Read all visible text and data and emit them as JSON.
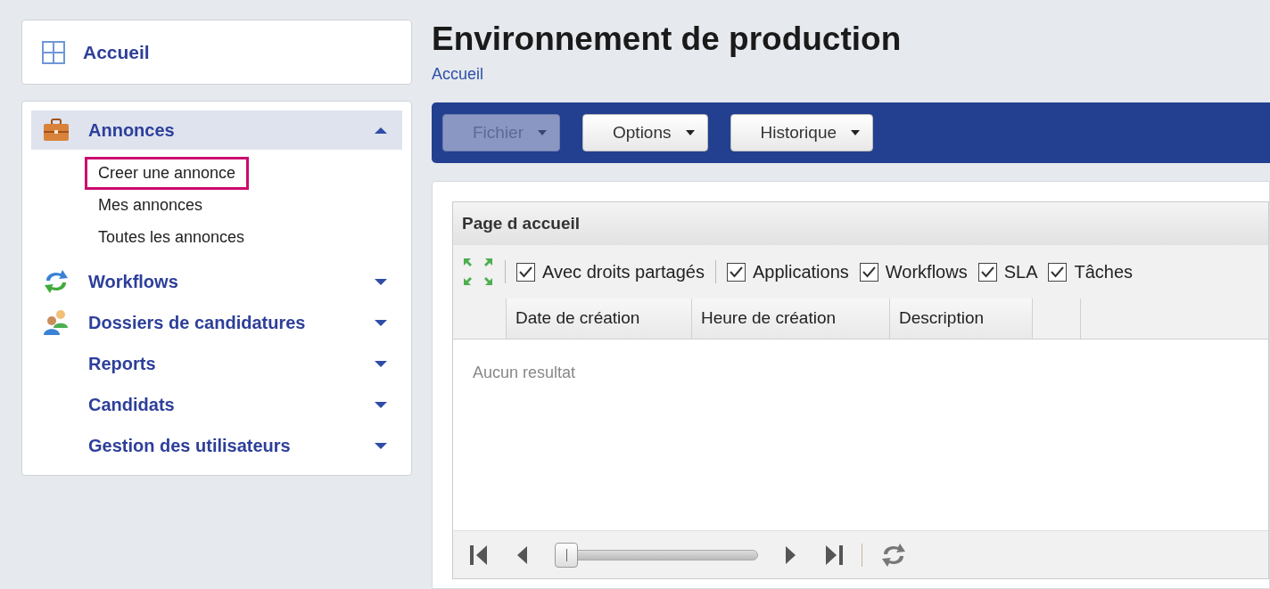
{
  "sidebar": {
    "home": "Accueil",
    "sections": [
      {
        "label": "Annonces",
        "expanded": true,
        "children": [
          {
            "label": "Creer une annonce",
            "highlighted": true
          },
          {
            "label": "Mes annonces",
            "highlighted": false
          },
          {
            "label": "Toutes les annonces",
            "highlighted": false
          }
        ]
      },
      {
        "label": "Workflows",
        "expanded": false
      },
      {
        "label": "Dossiers de candidatures",
        "expanded": false
      },
      {
        "label": "Reports",
        "expanded": false
      },
      {
        "label": "Candidats",
        "expanded": false
      },
      {
        "label": "Gestion des utilisateurs",
        "expanded": false
      }
    ]
  },
  "page": {
    "title": "Environnement de production",
    "breadcrumb": "Accueil"
  },
  "toolbar": [
    {
      "label": "Fichier",
      "disabled": true
    },
    {
      "label": "Options",
      "disabled": false
    },
    {
      "label": "Historique",
      "disabled": false
    }
  ],
  "grid": {
    "title": "Page d accueil",
    "filters": [
      {
        "label": "Avec droits partagés",
        "checked": true
      },
      {
        "label": "Applications",
        "checked": true
      },
      {
        "label": "Workflows",
        "checked": true
      },
      {
        "label": "SLA",
        "checked": true
      },
      {
        "label": "Tâches",
        "checked": true
      }
    ],
    "columns": [
      "Date de création",
      "Heure de création",
      "Description"
    ],
    "empty": "Aucun resultat"
  }
}
